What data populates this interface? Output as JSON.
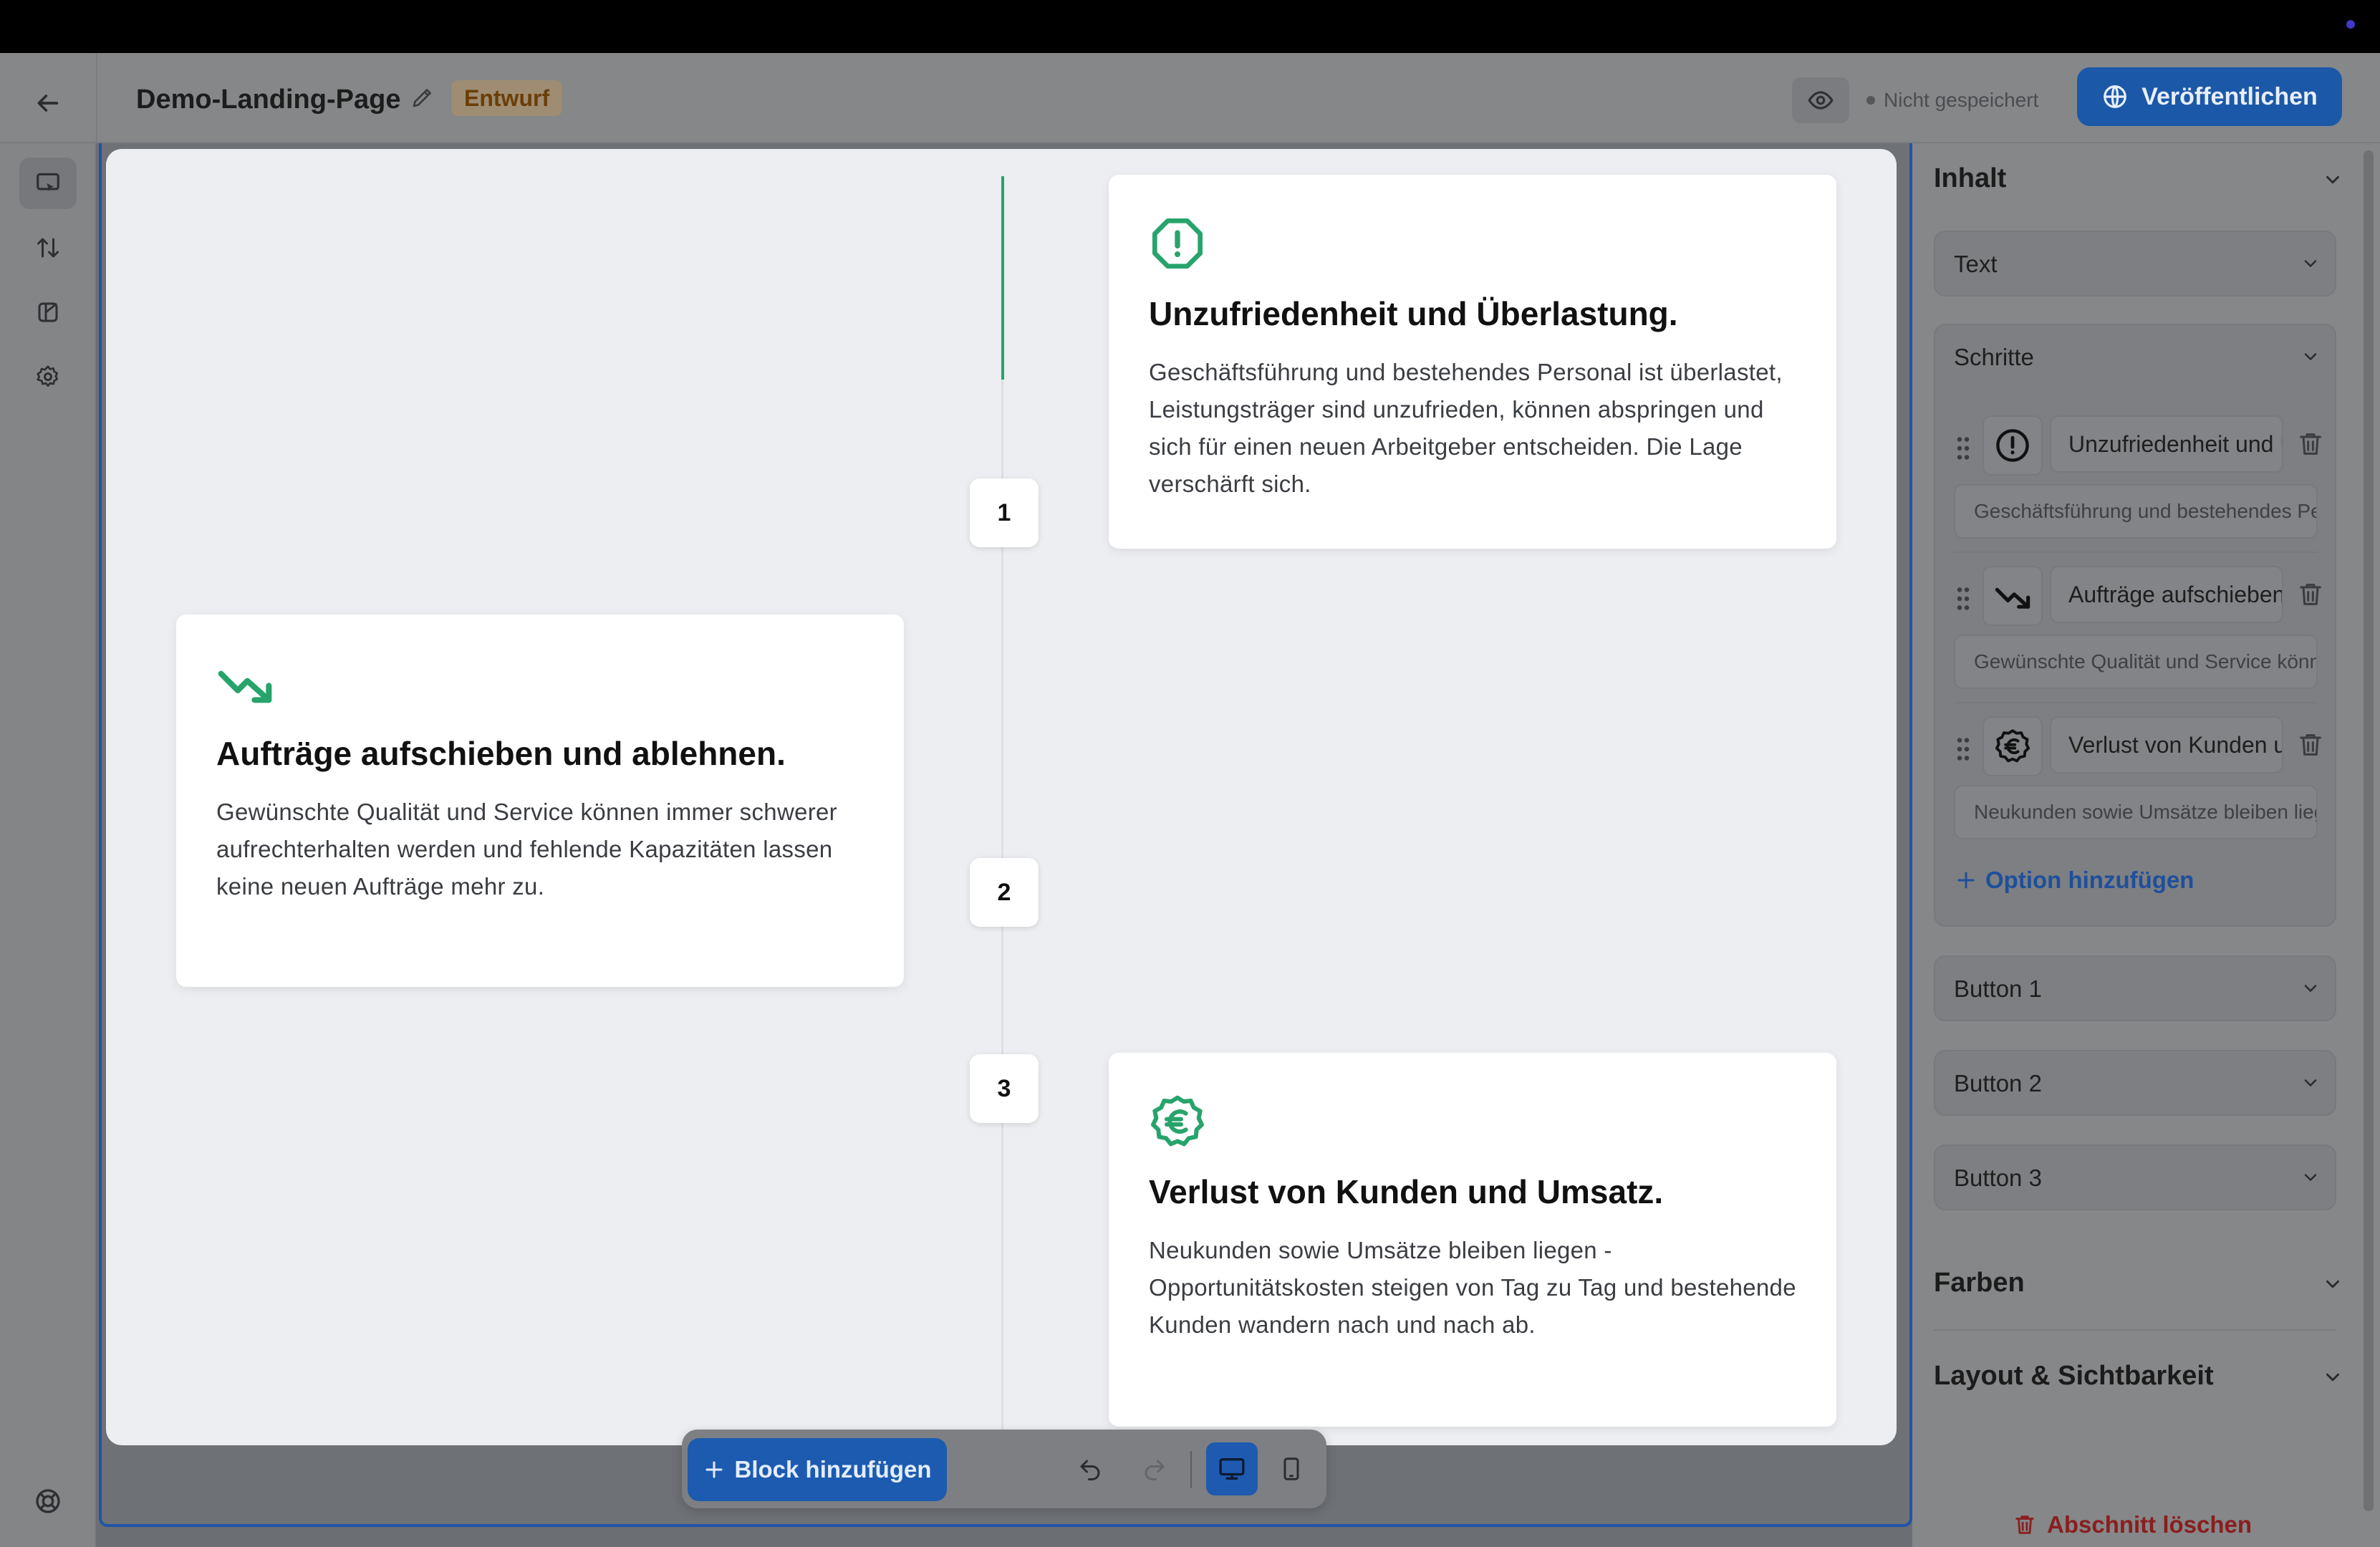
{
  "header": {
    "page_title": "Demo-Landing-Page",
    "draft_badge": "Entwurf",
    "save_status": "Nicht gespeichert",
    "publish_label": "Veröffentlichen"
  },
  "left_toolbar": {
    "icons": [
      "edit-block-icon",
      "reorder-icon",
      "layout-icon",
      "settings-icon",
      "help-icon"
    ]
  },
  "section": {
    "steps": [
      {
        "number": "1",
        "icon": "alert-octagon-icon",
        "title": "Unzufriedenheit und Überlastung.",
        "text": "Geschäftsführung und bestehendes Personal ist überlastet, Leistungsträger sind unzufrieden, können abspringen und sich für einen neuen Arbeitgeber entscheiden. Die Lage verschärft sich."
      },
      {
        "number": "2",
        "icon": "trending-down-icon",
        "title": "Aufträge aufschieben und ablehnen.",
        "text": "Gewünschte Qualität und Service können immer schwerer aufrechterhalten werden und fehlende Kapazitäten lassen keine neuen Aufträge mehr zu."
      },
      {
        "number": "3",
        "icon": "euro-badge-icon",
        "title": "Verlust von Kunden und Umsatz.",
        "text": "Neukunden sowie Umsätze bleiben liegen - Opportunitätskosten steigen von Tag zu Tag und bestehende Kunden wandern nach und nach ab."
      }
    ],
    "accent_color": "#27a46b"
  },
  "bottom_toolbar": {
    "add_block_label": "Block hinzufügen"
  },
  "right_panel": {
    "inhalt_label": "Inhalt",
    "text_label": "Text",
    "schritte_label": "Schritte",
    "step_items": [
      {
        "title_value": "Unzufriedenheit und Überlastung.",
        "desc_value": "Geschäftsführung und bestehendes Personal ist überlastet"
      },
      {
        "title_value": "Aufträge aufschieben und ablehnen.",
        "desc_value": "Gewünschte Qualität und Service können immer"
      },
      {
        "title_value": "Verlust von Kunden und Umsatz.",
        "desc_value": "Neukunden sowie Umsätze bleiben liegen"
      }
    ],
    "add_option_label": "Option hinzufügen",
    "button_1_label": "Button 1",
    "button_2_label": "Button 2",
    "button_3_label": "Button 3",
    "farben_label": "Farben",
    "layout_label": "Layout & Sichtbarkeit",
    "delete_section_label": "Abschnitt löschen"
  }
}
